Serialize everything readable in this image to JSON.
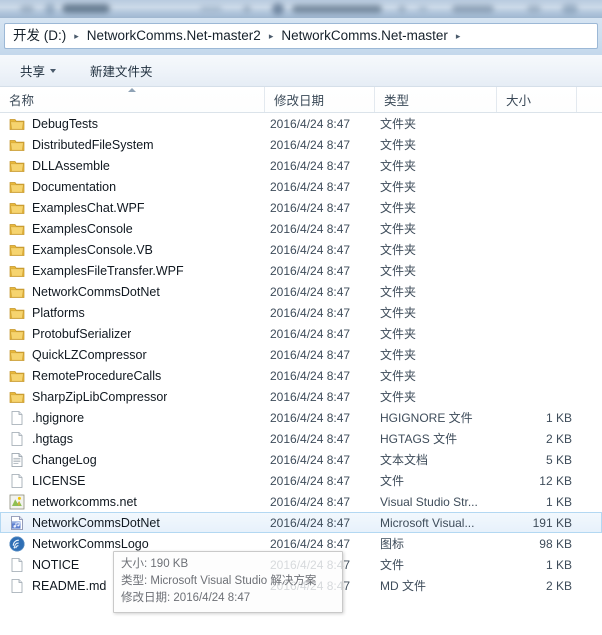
{
  "window": {
    "chrome_blurred": true
  },
  "address_bar": {
    "crumbs": [
      "开发 (D:)",
      "NetworkComms.Net-master2",
      "NetworkComms.Net-master"
    ],
    "separator": "▸",
    "trailing_separator": "▸"
  },
  "toolbar": {
    "share_label": "共享",
    "new_folder_label": "新建文件夹"
  },
  "columns": {
    "name": "名称",
    "date": "修改日期",
    "type": "类型",
    "size": "大小",
    "sorted_by": "名称",
    "sort_direction": "asc"
  },
  "files": [
    {
      "name": "DebugTests",
      "date": "2016/4/24 8:47",
      "type": "文件夹",
      "size": "",
      "icon": "folder-icon",
      "selected": false
    },
    {
      "name": "DistributedFileSystem",
      "date": "2016/4/24 8:47",
      "type": "文件夹",
      "size": "",
      "icon": "folder-icon",
      "selected": false
    },
    {
      "name": "DLLAssemble",
      "date": "2016/4/24 8:47",
      "type": "文件夹",
      "size": "",
      "icon": "folder-icon",
      "selected": false
    },
    {
      "name": "Documentation",
      "date": "2016/4/24 8:47",
      "type": "文件夹",
      "size": "",
      "icon": "folder-icon",
      "selected": false
    },
    {
      "name": "ExamplesChat.WPF",
      "date": "2016/4/24 8:47",
      "type": "文件夹",
      "size": "",
      "icon": "folder-icon",
      "selected": false
    },
    {
      "name": "ExamplesConsole",
      "date": "2016/4/24 8:47",
      "type": "文件夹",
      "size": "",
      "icon": "folder-icon",
      "selected": false
    },
    {
      "name": "ExamplesConsole.VB",
      "date": "2016/4/24 8:47",
      "type": "文件夹",
      "size": "",
      "icon": "folder-icon",
      "selected": false
    },
    {
      "name": "ExamplesFileTransfer.WPF",
      "date": "2016/4/24 8:47",
      "type": "文件夹",
      "size": "",
      "icon": "folder-icon",
      "selected": false
    },
    {
      "name": "NetworkCommsDotNet",
      "date": "2016/4/24 8:47",
      "type": "文件夹",
      "size": "",
      "icon": "folder-icon",
      "selected": false
    },
    {
      "name": "Platforms",
      "date": "2016/4/24 8:47",
      "type": "文件夹",
      "size": "",
      "icon": "folder-icon",
      "selected": false
    },
    {
      "name": "ProtobufSerializer",
      "date": "2016/4/24 8:47",
      "type": "文件夹",
      "size": "",
      "icon": "folder-icon",
      "selected": false
    },
    {
      "name": "QuickLZCompressor",
      "date": "2016/4/24 8:47",
      "type": "文件夹",
      "size": "",
      "icon": "folder-icon",
      "selected": false
    },
    {
      "name": "RemoteProcedureCalls",
      "date": "2016/4/24 8:47",
      "type": "文件夹",
      "size": "",
      "icon": "folder-icon",
      "selected": false
    },
    {
      "name": "SharpZipLibCompressor",
      "date": "2016/4/24 8:47",
      "type": "文件夹",
      "size": "",
      "icon": "folder-icon",
      "selected": false
    },
    {
      "name": ".hgignore",
      "date": "2016/4/24 8:47",
      "type": "HGIGNORE 文件",
      "size": "1 KB",
      "icon": "blank-file-icon",
      "selected": false
    },
    {
      "name": ".hgtags",
      "date": "2016/4/24 8:47",
      "type": "HGTAGS 文件",
      "size": "2 KB",
      "icon": "blank-file-icon",
      "selected": false
    },
    {
      "name": "ChangeLog",
      "date": "2016/4/24 8:47",
      "type": "文本文档",
      "size": "5 KB",
      "icon": "text-file-icon",
      "selected": false
    },
    {
      "name": "LICENSE",
      "date": "2016/4/24 8:47",
      "type": "文件",
      "size": "12 KB",
      "icon": "blank-file-icon",
      "selected": false
    },
    {
      "name": "networkcomms.net",
      "date": "2016/4/24 8:47",
      "type": "Visual Studio Str...",
      "size": "1 KB",
      "icon": "vs-solution-icon",
      "selected": false
    },
    {
      "name": "NetworkCommsDotNet",
      "date": "2016/4/24 8:47",
      "type": "Microsoft Visual...",
      "size": "191 KB",
      "icon": "vs-project-icon",
      "selected": true
    },
    {
      "name": "NetworkCommsLogo",
      "date": "2016/4/24 8:47",
      "type": "图标",
      "size": "98 KB",
      "icon": "logo-wifi-icon",
      "selected": false
    },
    {
      "name": "NOTICE",
      "date": "2016/4/24 8:47",
      "type": "文件",
      "size": "1 KB",
      "icon": "blank-file-icon",
      "selected": false
    },
    {
      "name": "README.md",
      "date": "2016/4/24 8:47",
      "type": "MD 文件",
      "size": "2 KB",
      "icon": "blank-file-icon",
      "selected": false
    }
  ],
  "tooltip": {
    "size_label": "大小:",
    "size_value": "190 KB",
    "type_label": "类型:",
    "type_value": "Microsoft Visual Studio 解决方案",
    "date_label": "修改日期:",
    "date_value": "2016/4/24 8:47"
  },
  "colors": {
    "selection_bg": "#e7f1fb",
    "selection_border": "#b3d8f2",
    "folder_yellow": "#f0c14b",
    "address_bg": "#cfe0f0"
  }
}
